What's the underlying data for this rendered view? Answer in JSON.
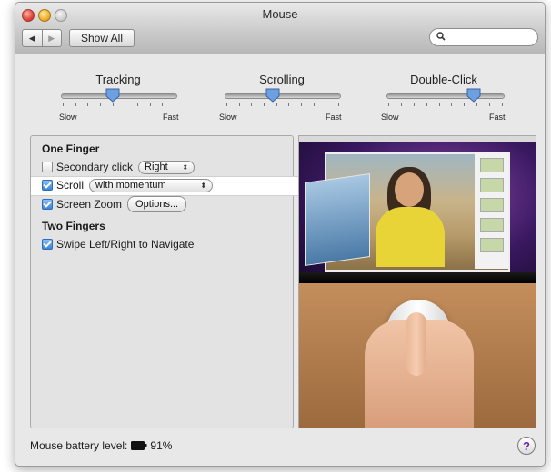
{
  "window": {
    "title": "Mouse"
  },
  "toolbar": {
    "back_icon": "chevron-left-icon",
    "forward_icon": "chevron-right-icon",
    "show_all_label": "Show All",
    "search": {
      "value": "",
      "icon": "search-icon"
    }
  },
  "sliders": {
    "tracking": {
      "title": "Tracking",
      "min_label": "Slow",
      "max_label": "Fast",
      "value_fraction": 0.45
    },
    "scrolling": {
      "title": "Scrolling",
      "min_label": "Slow",
      "max_label": "Fast",
      "value_fraction": 0.42
    },
    "double_click": {
      "title": "Double-Click",
      "min_label": "Slow",
      "max_label": "Fast",
      "value_fraction": 0.75
    }
  },
  "one_finger": {
    "heading": "One Finger",
    "secondary_click": {
      "label": "Secondary click",
      "checked": false,
      "popup_value": "Right"
    },
    "scroll": {
      "label": "Scroll",
      "checked": true,
      "popup_value": "with momentum"
    },
    "screen_zoom": {
      "label": "Screen Zoom",
      "checked": true,
      "options_label": "Options..."
    }
  },
  "two_fingers": {
    "heading": "Two Fingers",
    "swipe": {
      "label": "Swipe Left/Right to Navigate",
      "checked": true
    }
  },
  "footer": {
    "battery_label": "Mouse battery level:",
    "battery_percent": "91%",
    "help_label": "?"
  },
  "colors": {
    "accent": "#3c86d8",
    "help": "#6a2aa6"
  }
}
